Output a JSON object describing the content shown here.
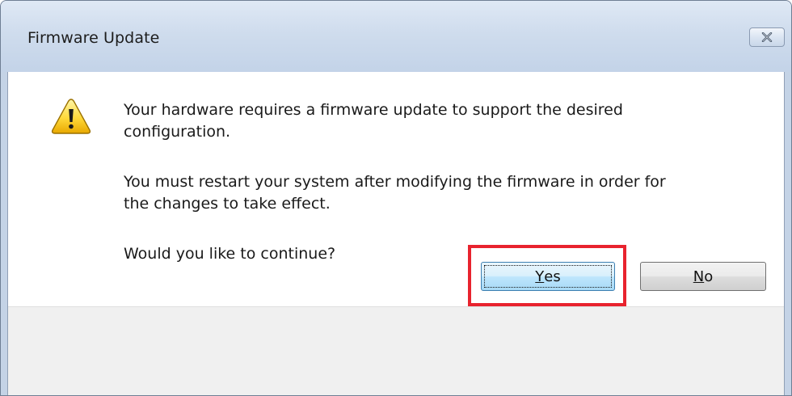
{
  "dialog": {
    "title": "Firmware Update",
    "close_icon": "close-icon",
    "warning_icon": "warning-triangle-icon",
    "message_lines": [
      "Your hardware requires a firmware update to support the desired",
      "configuration.",
      "You must restart your system after modifying the firmware in order for",
      "the changes to take effect.",
      "Would you like to continue?"
    ],
    "buttons": {
      "yes": {
        "mnemonic": "Y",
        "rest": "es"
      },
      "no": {
        "mnemonic": "N",
        "rest": "o"
      }
    },
    "highlight_color": "#e8232e"
  }
}
